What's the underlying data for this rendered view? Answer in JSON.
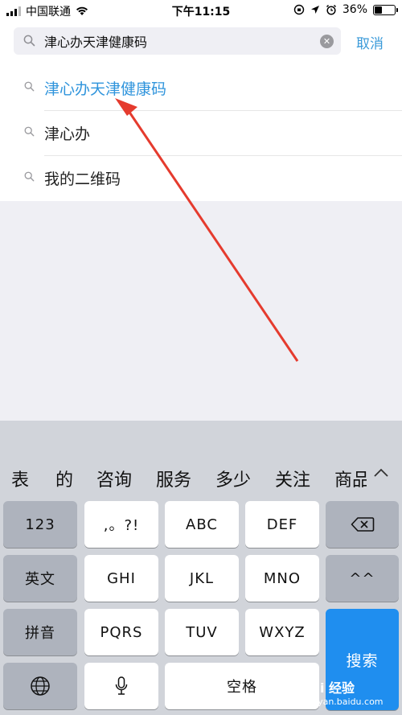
{
  "status_bar": {
    "carrier": "中国联通",
    "time": "下午11:15",
    "battery": "36%",
    "battery_level": 0.36
  },
  "search": {
    "value": "津心办天津健康码",
    "placeholder": "",
    "cancel_label": "取消"
  },
  "suggestions": [
    {
      "label": "津心办天津健康码",
      "highlight": true
    },
    {
      "label": "津心办",
      "highlight": false
    },
    {
      "label": "我的二维码",
      "highlight": false
    }
  ],
  "keyboard": {
    "candidates": [
      "表",
      "的",
      "咨询",
      "服务",
      "多少",
      "关注",
      "商品"
    ],
    "keys": {
      "numbers": "123",
      "punct": ",。?!",
      "abc": "ABC",
      "def": "DEF",
      "lang": "英文",
      "ghi": "GHI",
      "jkl": "JKL",
      "mno": "MNO",
      "emoticon": "^^",
      "pinyin": "拼音",
      "pqrs": "PQRS",
      "tuv": "TUV",
      "wxyz": "WXYZ",
      "search": "搜索",
      "space": "空格"
    }
  },
  "watermark": {
    "brand": "Bai 经验",
    "url": "jingyan.baidu.com"
  },
  "icons": {
    "search": "search-icon",
    "clear": "clear-icon",
    "delete": "backspace-icon",
    "globe": "globe-icon",
    "mic": "microphone-icon",
    "expand": "chevron-up-icon"
  }
}
